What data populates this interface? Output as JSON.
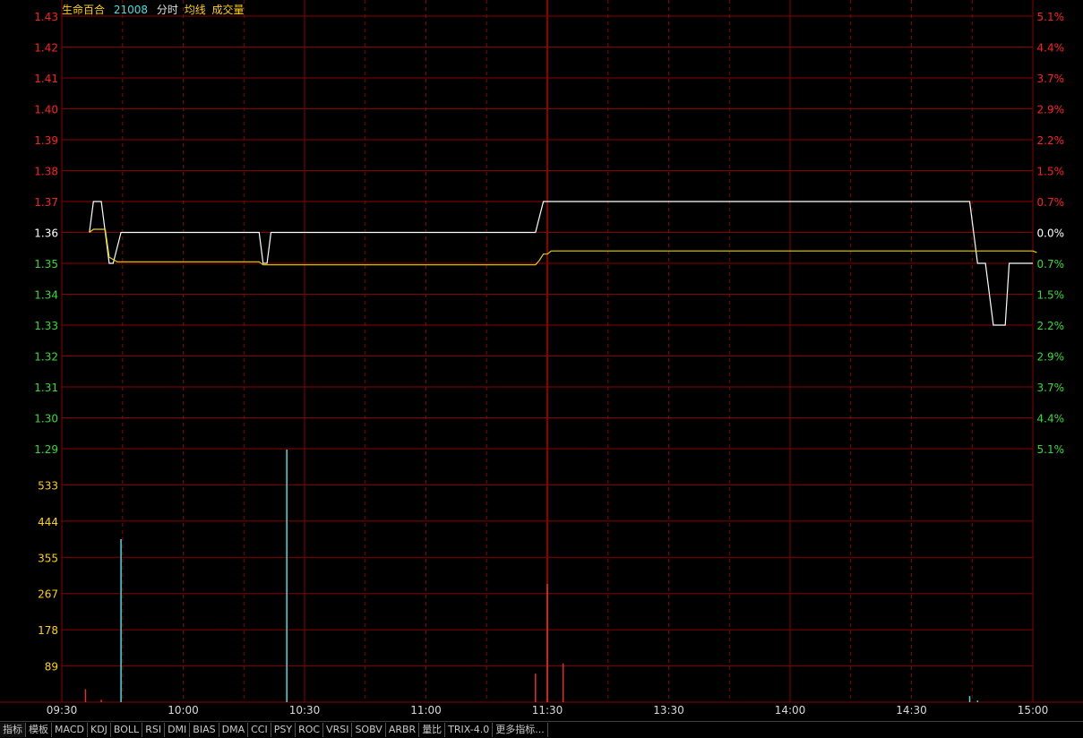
{
  "header": {
    "stock_name": "生命百合",
    "stock_code": "21008",
    "indicators": [
      "分时",
      "均线",
      "成交量"
    ]
  },
  "colors": {
    "grid": "#8b0000",
    "up": "#ff2020",
    "down": "#33dd33",
    "flat": "#ffffff",
    "price_line": "#ffffff",
    "avg_line": "#e6d200",
    "volume_up": "#e03030",
    "volume_down": "#40e0e0",
    "volume_label": "#ffd200",
    "time_label": "#d8d8d8"
  },
  "chart_data": {
    "type": "line",
    "title": "",
    "prev_close": 1.36,
    "price_axis": {
      "ticks": [
        1.43,
        1.42,
        1.41,
        1.4,
        1.39,
        1.38,
        1.37,
        1.36,
        1.35,
        1.34,
        1.33,
        1.32,
        1.31,
        1.3,
        1.29
      ],
      "ylim": [
        1.29,
        1.43
      ]
    },
    "pct_axis": {
      "ticks": [
        "5.1%",
        "4.4%",
        "3.7%",
        "2.9%",
        "2.2%",
        "1.5%",
        "0.7%",
        "0.0%",
        "0.7%",
        "1.5%",
        "2.2%",
        "2.9%",
        "3.7%",
        "4.4%",
        "5.1%"
      ]
    },
    "volume_axis": {
      "ticks": [
        533,
        444,
        355,
        267,
        178,
        89
      ],
      "ylim": [
        0,
        622
      ]
    },
    "x_ticks": [
      "09:30",
      "10:00",
      "10:30",
      "11:00",
      "11:30",
      "13:30",
      "14:00",
      "14:30",
      "15:00"
    ],
    "session_minutes": 240,
    "series": [
      {
        "kind": "price",
        "points": [
          [
            7,
            1.36
          ],
          [
            8,
            1.37
          ],
          [
            10,
            1.37
          ],
          [
            12,
            1.35
          ],
          [
            13,
            1.35
          ],
          [
            15,
            1.36
          ],
          [
            50,
            1.36
          ],
          [
            51,
            1.35
          ],
          [
            52,
            1.35
          ],
          [
            53,
            1.36
          ],
          [
            120,
            1.36
          ],
          [
            122,
            1.37
          ],
          [
            230,
            1.37
          ],
          [
            232,
            1.35
          ],
          [
            234,
            1.35
          ],
          [
            236,
            1.33
          ],
          [
            239,
            1.33
          ],
          [
            240,
            1.35
          ],
          [
            246,
            1.35
          ]
        ]
      },
      {
        "kind": "avg",
        "points": [
          [
            7,
            1.36
          ],
          [
            8,
            1.361
          ],
          [
            11,
            1.361
          ],
          [
            12,
            1.352
          ],
          [
            14,
            1.3505
          ],
          [
            50,
            1.3505
          ],
          [
            51,
            1.3495
          ],
          [
            120,
            1.3495
          ],
          [
            121,
            1.351
          ],
          [
            122,
            1.353
          ],
          [
            123,
            1.353
          ],
          [
            124,
            1.354
          ],
          [
            230,
            1.354
          ],
          [
            246,
            1.354
          ],
          [
            247,
            1.3535
          ]
        ]
      }
    ],
    "volume_bars": [
      {
        "t": 6,
        "v": 32,
        "dir": "up"
      },
      {
        "t": 10,
        "v": 6,
        "dir": "up"
      },
      {
        "t": 15,
        "v": 400,
        "dir": "down"
      },
      {
        "t": 57,
        "v": 620,
        "dir": "down"
      },
      {
        "t": 120,
        "v": 70,
        "dir": "up"
      },
      {
        "t": 123,
        "v": 290,
        "dir": "up"
      },
      {
        "t": 127,
        "v": 95,
        "dir": "up"
      },
      {
        "t": 230,
        "v": 15,
        "dir": "down"
      },
      {
        "t": 232,
        "v": 4,
        "dir": "down"
      }
    ]
  },
  "bottom_tabs": [
    "指标",
    "模板",
    "MACD",
    "KDJ",
    "BOLL",
    "RSI",
    "DMI",
    "BIAS",
    "DMA",
    "CCI",
    "PSY",
    "ROC",
    "VRSI",
    "SOBV",
    "ARBR",
    "量比",
    "TRIX-4.0",
    "更多指标..."
  ]
}
